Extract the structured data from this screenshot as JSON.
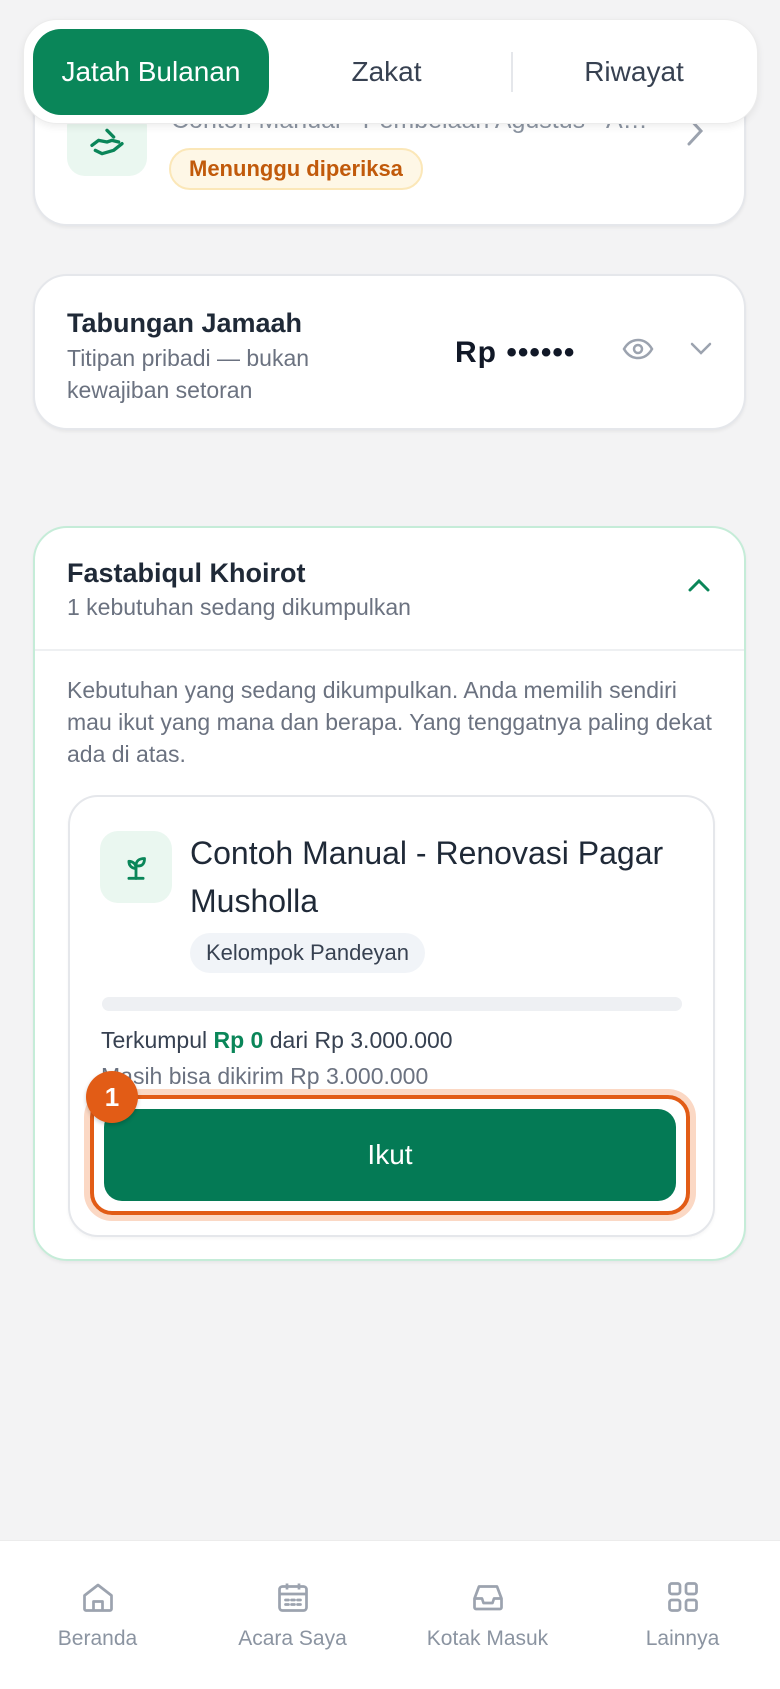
{
  "tabs": [
    {
      "label": "Jatah Bulanan",
      "active": true
    },
    {
      "label": "Zakat",
      "active": false
    },
    {
      "label": "Riwayat",
      "active": false
    }
  ],
  "pending": {
    "title": "Contoh Manual - Pembelaan Agustus - Ag...",
    "status": "Menunggu diperiksa"
  },
  "tabungan": {
    "title": "Tabungan Jamaah",
    "subtitle": "Titipan pribadi — bukan kewajiban setoran",
    "amount_masked": "Rp ••••••"
  },
  "fastabiqul": {
    "title": "Fastabiqul Khoirot",
    "subtitle": "1 kebutuhan sedang dikumpulkan",
    "description": "Kebutuhan yang sedang dikumpulkan. Anda memilih sendiri mau ikut yang mana dan berapa. Yang tenggatnya paling dekat ada di atas.",
    "need": {
      "title": "Contoh Manual - Renovasi Pagar Musholla",
      "group": "Kelompok Pandeyan",
      "progress_fraction": 0,
      "collected_prefix": "Terkumpul",
      "collected_amount": "Rp 0",
      "collected_suffix": "dari Rp 3.000.000",
      "remaining": "Masih bisa dikirim Rp 3.000.000",
      "join_label": "Ikut",
      "step_number": "1"
    }
  },
  "nav": [
    {
      "label": "Beranda",
      "icon": "home-icon"
    },
    {
      "label": "Acara Saya",
      "icon": "calendar-icon"
    },
    {
      "label": "Kotak Masuk",
      "icon": "inbox-icon"
    },
    {
      "label": "Lainnya",
      "icon": "grid-icon"
    }
  ],
  "colors": {
    "primary": "#0a8659",
    "accent": "#e25c16"
  }
}
